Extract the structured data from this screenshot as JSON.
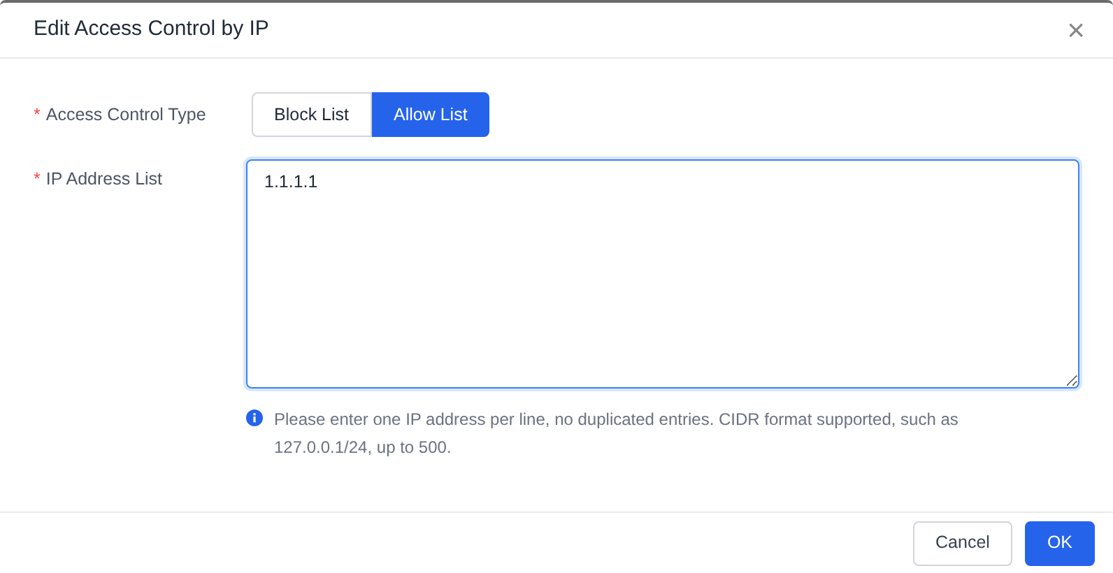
{
  "dialog": {
    "title": "Edit Access Control by IP",
    "close": "×"
  },
  "fields": [
    {
      "kind": "segmented",
      "required_mark": "*",
      "label": "Access Control Type",
      "options": [
        {
          "label": "Block List",
          "selected": false
        },
        {
          "label": "Allow List",
          "selected": true
        }
      ]
    },
    {
      "kind": "textarea",
      "required_mark": "*",
      "label": "IP Address List",
      "value": "1.1.1.1",
      "focused": true,
      "help": "Please enter one IP address per line, no duplicated entries. CIDR format supported, such as 127.0.0.1/24, up to 500."
    }
  ],
  "buttons": [
    {
      "label": "Cancel",
      "kind": "secondary"
    },
    {
      "label": "OK",
      "kind": "primary"
    }
  ]
}
